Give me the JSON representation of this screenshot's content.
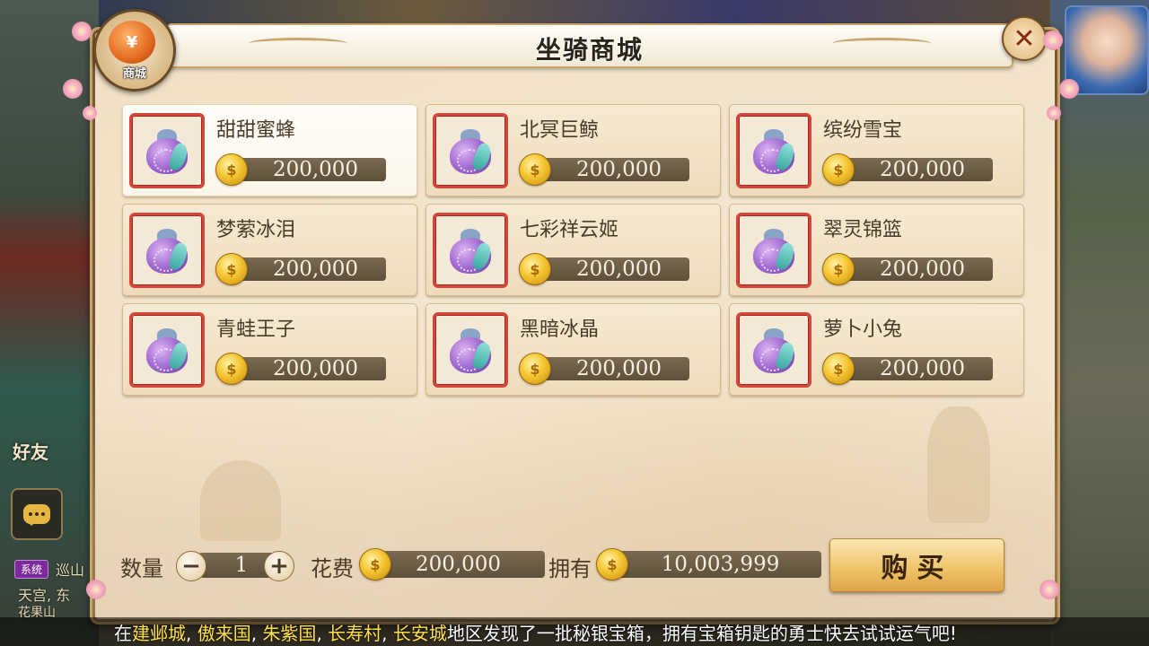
{
  "panel": {
    "title": "坐骑商城",
    "emblem_label": "商城",
    "emblem_glyph": "¥",
    "close_glyph": "✕"
  },
  "items": [
    {
      "name": "甜甜蜜蜂",
      "price": "200,000",
      "selected": true
    },
    {
      "name": "北冥巨鲸",
      "price": "200,000",
      "selected": false
    },
    {
      "name": "缤纷雪宝",
      "price": "200,000",
      "selected": false
    },
    {
      "name": "梦萦冰泪",
      "price": "200,000",
      "selected": false
    },
    {
      "name": "七彩祥云姬",
      "price": "200,000",
      "selected": false
    },
    {
      "name": "翠灵锦篮",
      "price": "200,000",
      "selected": false
    },
    {
      "name": "青蛙王子",
      "price": "200,000",
      "selected": false
    },
    {
      "name": "黑暗冰晶",
      "price": "200,000",
      "selected": false
    },
    {
      "name": "萝卜小兔",
      "price": "200,000",
      "selected": false
    }
  ],
  "purchase": {
    "quantity_label": "数量",
    "quantity": "1",
    "minus_glyph": "−",
    "plus_glyph": "+",
    "cost_label": "花费",
    "cost": "200,000",
    "own_label": "拥有",
    "own": "10,003,999",
    "buy_label": "购买"
  },
  "hud": {
    "friend_label": "好友",
    "system_tag": "系统",
    "chat_line1": "巡山",
    "chat_line2": "天宫, 东",
    "chat_line3": "花果山"
  },
  "broadcast": {
    "prefix": "在",
    "places": [
      "建邺城",
      "傲来国",
      "朱紫国",
      "长寿村",
      "长安城"
    ],
    "separator": ", ",
    "suffix": "地区发现了一批秘银宝箱，拥有宝箱钥匙的勇士快去试试运气吧!"
  },
  "colors": {
    "highlight": "#ffe24a",
    "frame": "#d5453a",
    "accent": "#f0c56c"
  },
  "icons": {
    "item_icon": "purple-pouch-icon",
    "currency": "gold-coin-icon",
    "chat": "chat-bubble-icon",
    "close": "close-icon"
  }
}
